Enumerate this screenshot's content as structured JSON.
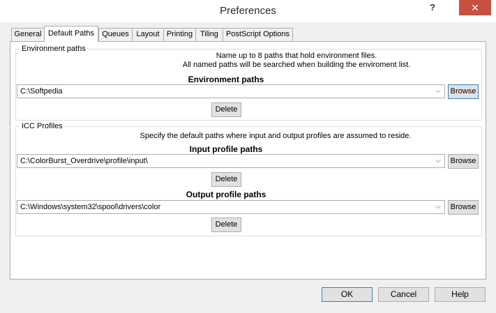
{
  "window": {
    "title": "Preferences",
    "help_label": "?",
    "close_label": "✕"
  },
  "tabs": [
    {
      "label": "General"
    },
    {
      "label": "Default Paths"
    },
    {
      "label": "Queues"
    },
    {
      "label": "Layout"
    },
    {
      "label": "Printing"
    },
    {
      "label": "Tiling"
    },
    {
      "label": "PostScript Options"
    }
  ],
  "environment": {
    "group_label": "Environment paths",
    "info_line1": "Name up to 8 paths that hold environment files.",
    "info_line2": "All named paths will be searched when building the enviroment list.",
    "heading": "Environment paths",
    "path_value": "C:\\Softpedia",
    "browse_label": "Browse",
    "delete_label": "Delete"
  },
  "icc": {
    "group_label": "ICC Profiles",
    "info": "Specify the default paths where input and output profiles are assumed to reside.",
    "input_heading": "Input profile paths",
    "input_value": "C:\\ColorBurst_Overdrive\\profile\\input\\",
    "input_browse_label": "Browse",
    "input_delete_label": "Delete",
    "output_heading": "Output profile paths",
    "output_value": "C:\\Windows\\system32\\spool\\drivers\\color",
    "output_browse_label": "Browse",
    "output_delete_label": "Delete"
  },
  "footer": {
    "ok_label": "OK",
    "cancel_label": "Cancel",
    "help_label": "Help"
  },
  "colors": {
    "close_button": "#c7503f",
    "focus_border": "#3c7fb1"
  }
}
